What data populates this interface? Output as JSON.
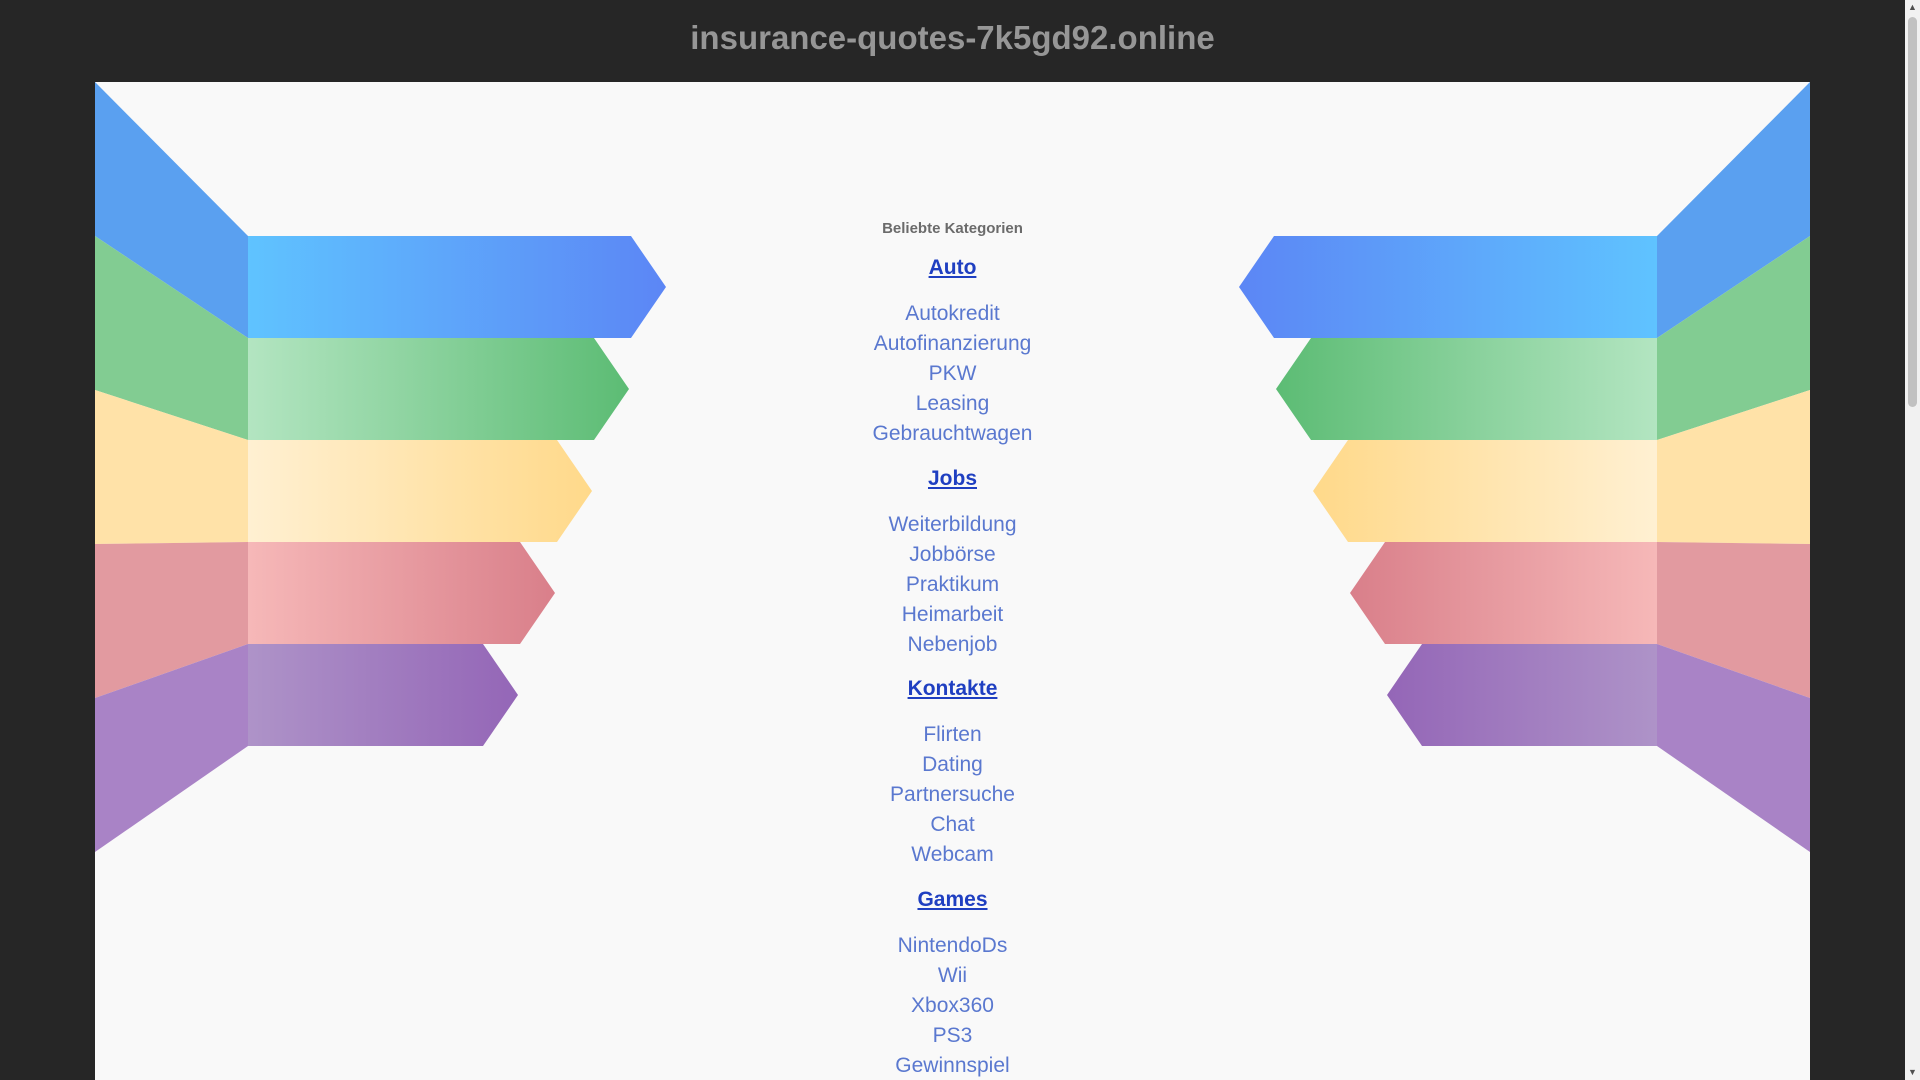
{
  "header": {
    "domain": "insurance-quotes-7k5gd92.online"
  },
  "main": {
    "section_title": "Beliebte Kategorien",
    "categories": [
      {
        "title": "Auto",
        "links": [
          "Autokredit",
          "Autofinanzierung",
          "PKW",
          "Leasing",
          "Gebrauchtwagen"
        ]
      },
      {
        "title": "Jobs",
        "links": [
          "Weiterbildung",
          "Jobbörse",
          "Praktikum",
          "Heimarbeit",
          "Nebenjob"
        ]
      },
      {
        "title": "Kontakte",
        "links": [
          "Flirten",
          "Dating",
          "Partnersuche",
          "Chat",
          "Webcam"
        ]
      },
      {
        "title": "Games",
        "links": [
          "NintendoDs",
          "Wii",
          "Xbox360",
          "PS3",
          "Gewinnspiel"
        ]
      }
    ]
  },
  "colors": {
    "background": "#262626",
    "panel": "#f9f9f9",
    "heading_link": "#1f3fc1",
    "link": "#5a78cf",
    "stripes": [
      "#5aa8ff",
      "#7dcc8a",
      "#ffe0a0",
      "#e79aa0",
      "#a782c4"
    ]
  }
}
